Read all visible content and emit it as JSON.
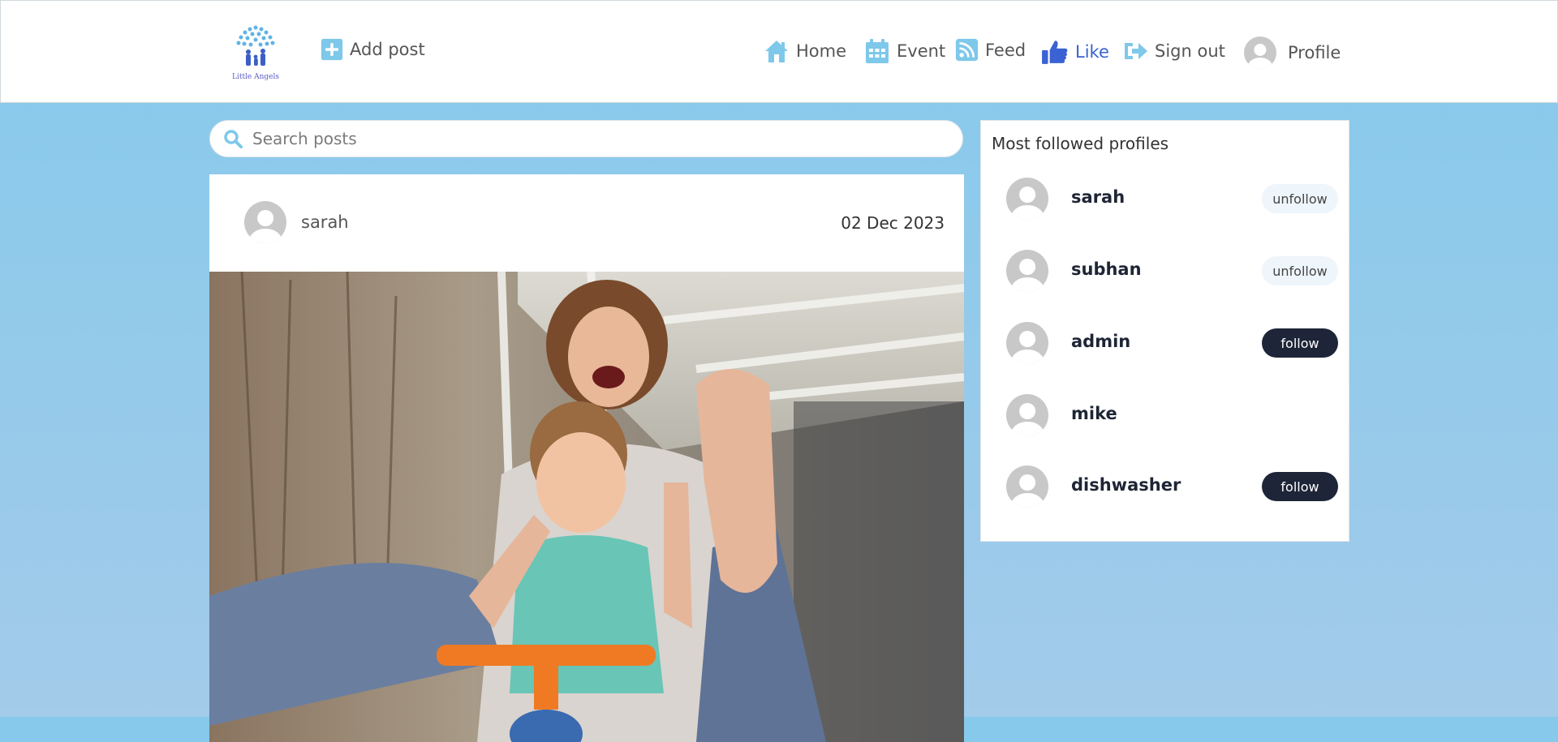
{
  "header": {
    "logo_text": "Little Angels",
    "add_post": "Add post",
    "nav": [
      {
        "label": "Home",
        "icon": "home-icon"
      },
      {
        "label": "Event",
        "icon": "calendar-icon"
      },
      {
        "label": "Feed",
        "icon": "rss-icon"
      },
      {
        "label": "Like",
        "icon": "thumbs-up-icon",
        "active": true
      },
      {
        "label": "Sign out",
        "icon": "sign-out-icon"
      },
      {
        "label": "Profile",
        "icon": "avatar"
      }
    ]
  },
  "search": {
    "placeholder": "Search posts"
  },
  "post": {
    "author": "sarah",
    "date": "02 Dec 2023"
  },
  "sidebar": {
    "title": "Most followed profiles",
    "profiles": [
      {
        "name": "sarah",
        "action": "unfollow"
      },
      {
        "name": "subhan",
        "action": "unfollow"
      },
      {
        "name": "admin",
        "action": "follow"
      },
      {
        "name": "mike",
        "action": ""
      },
      {
        "name": "dishwasher",
        "action": "follow"
      }
    ]
  },
  "colors": {
    "accent": "#86c9eb",
    "active": "#3a62d3",
    "dark_button": "#1e2538",
    "icon": "#7ec8ea"
  }
}
